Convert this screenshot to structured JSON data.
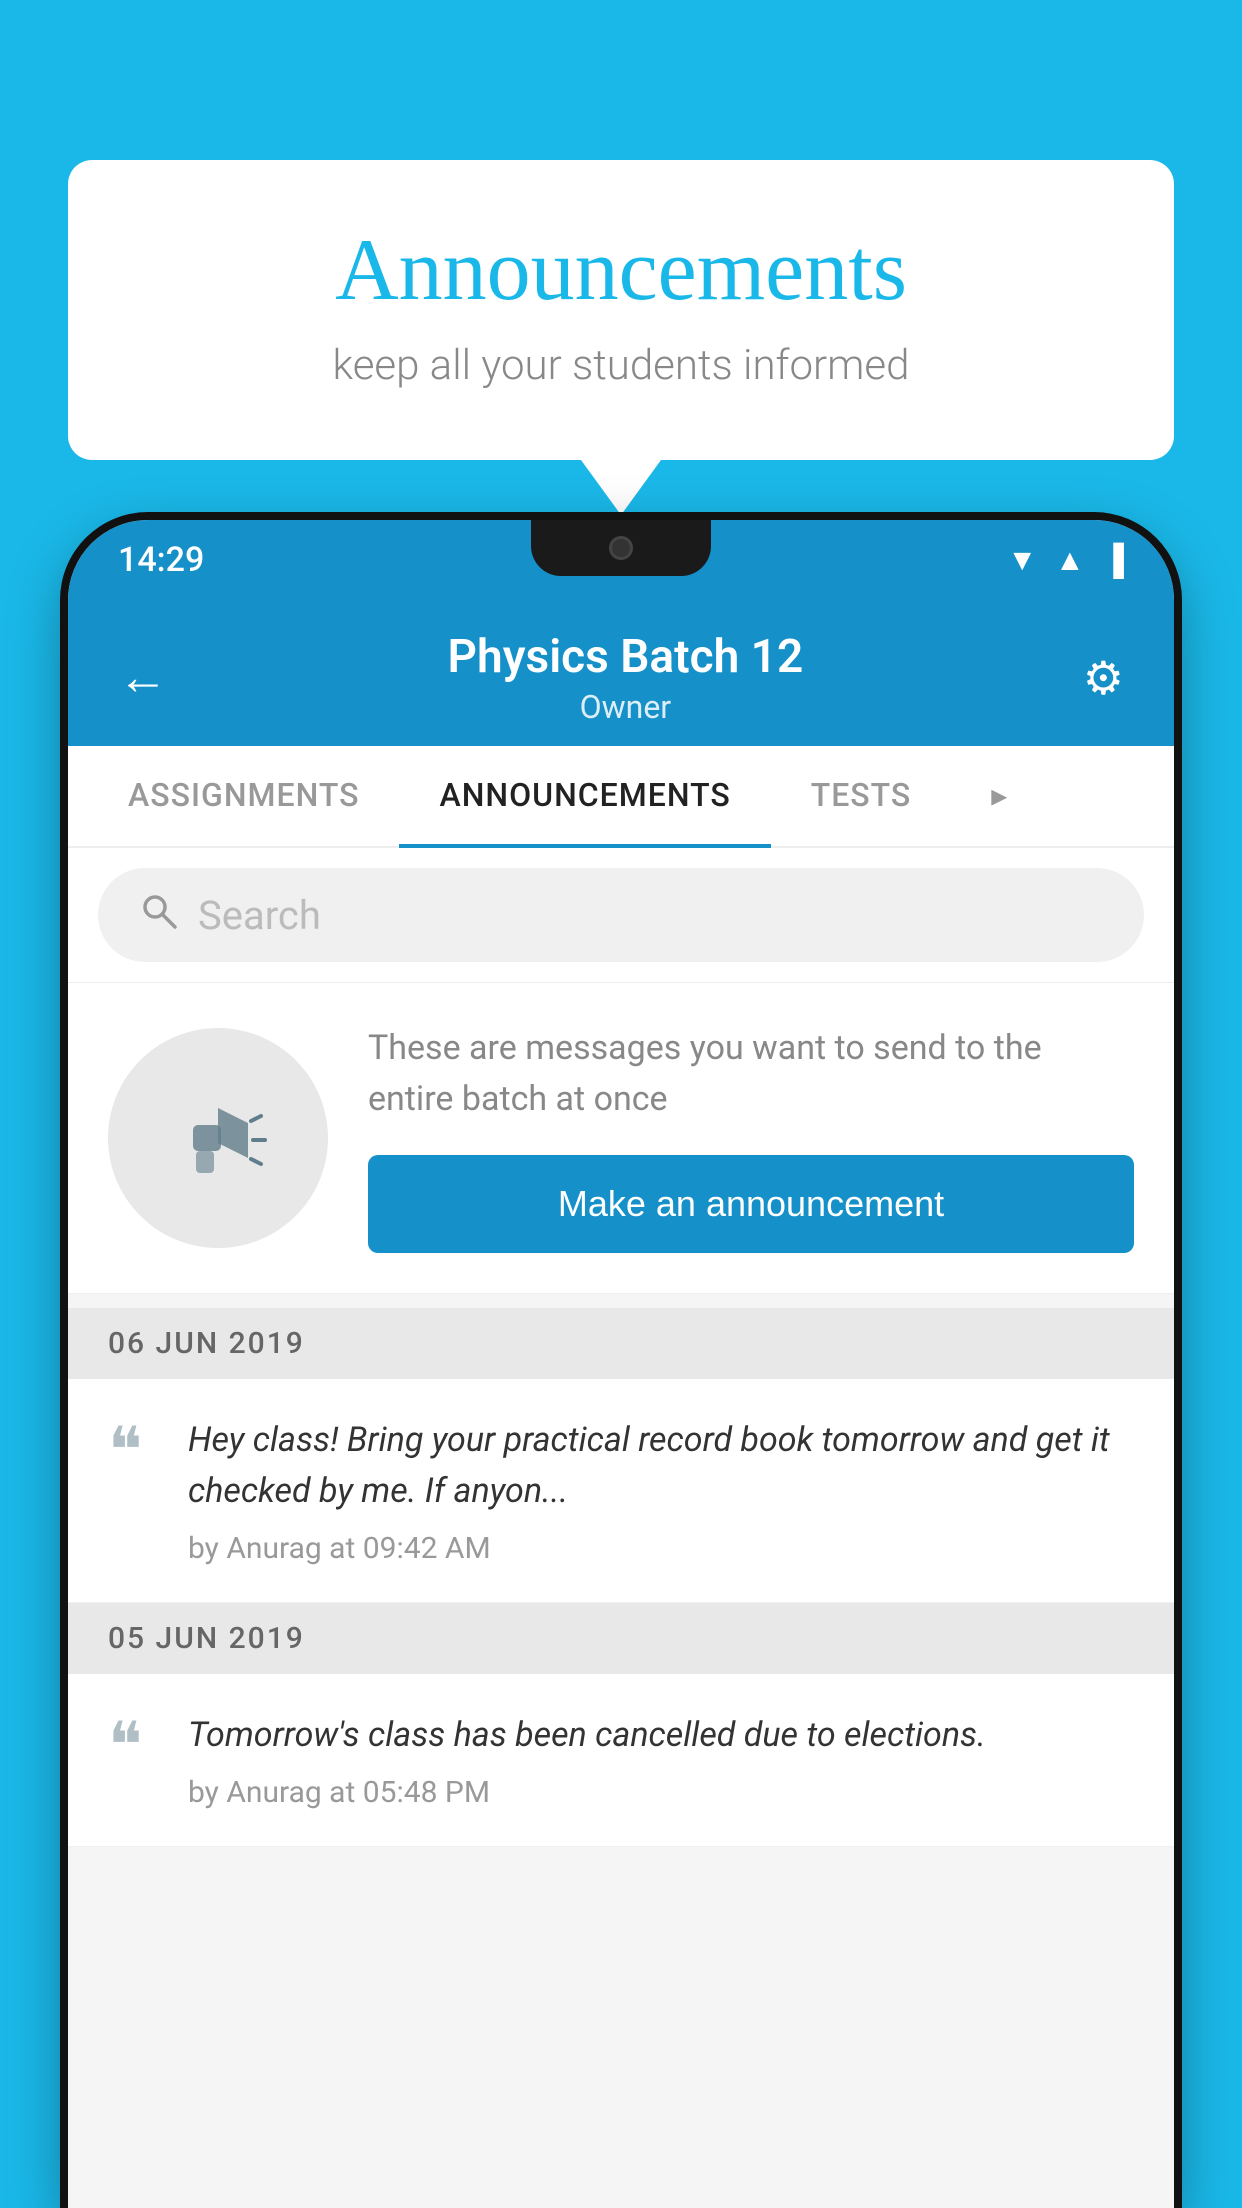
{
  "background_color": "#1ab8e8",
  "speech_bubble": {
    "title": "Announcements",
    "subtitle": "keep all your students informed"
  },
  "phone": {
    "status_bar": {
      "time": "14:29",
      "signal_icons": [
        "▲",
        "▲",
        "▐"
      ]
    },
    "header": {
      "title": "Physics Batch 12",
      "subtitle": "Owner",
      "back_label": "←",
      "settings_label": "⚙"
    },
    "tabs": [
      {
        "label": "ASSIGNMENTS",
        "active": false
      },
      {
        "label": "ANNOUNCEMENTS",
        "active": true
      },
      {
        "label": "TESTS",
        "active": false
      },
      {
        "label": "•",
        "active": false
      }
    ],
    "search": {
      "placeholder": "Search"
    },
    "announcement_promo": {
      "description": "These are messages you want to send to the entire batch at once",
      "button_label": "Make an announcement"
    },
    "announcements": [
      {
        "date": "06  JUN  2019",
        "items": [
          {
            "message": "Hey class! Bring your practical record book tomorrow and get it checked by me. If anyon...",
            "meta": "by Anurag at 09:42 AM"
          }
        ]
      },
      {
        "date": "05  JUN  2019",
        "items": [
          {
            "message": "Tomorrow's class has been cancelled due to elections.",
            "meta": "by Anurag at 05:48 PM"
          }
        ]
      }
    ]
  }
}
